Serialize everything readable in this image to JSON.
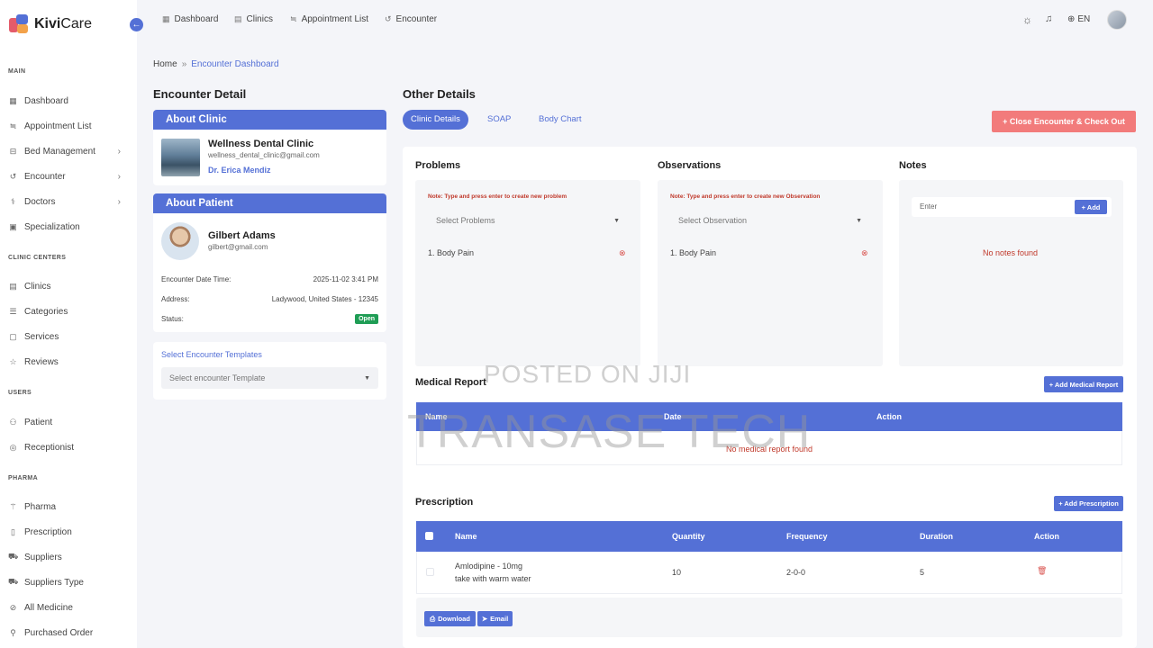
{
  "brand": {
    "name_a": "Kivi",
    "name_b": "Care"
  },
  "sidebar": {
    "sections": {
      "main": "MAIN",
      "clinic_centers": "CLINIC CENTERS",
      "users": "USERS",
      "pharma": "PHARMA"
    },
    "items": [
      {
        "label": "Dashboard",
        "icon": "grid-icon"
      },
      {
        "label": "Appointment List",
        "icon": "list-icon"
      },
      {
        "label": "Bed Management",
        "icon": "bed-icon"
      },
      {
        "label": "Encounter",
        "icon": "history-icon"
      },
      {
        "label": "Doctors",
        "icon": "doctor-icon"
      },
      {
        "label": "Specialization",
        "icon": "specialization-icon"
      },
      {
        "label": "Clinics",
        "icon": "clinic-icon"
      },
      {
        "label": "Categories",
        "icon": "categories-icon"
      },
      {
        "label": "Services",
        "icon": "services-icon"
      },
      {
        "label": "Reviews",
        "icon": "star-icon"
      },
      {
        "label": "Patient",
        "icon": "users-icon"
      },
      {
        "label": "Receptionist",
        "icon": "receptionist-icon"
      },
      {
        "label": "Pharma",
        "icon": "pharma-icon"
      },
      {
        "label": "Prescription",
        "icon": "prescription-icon"
      },
      {
        "label": "Suppliers",
        "icon": "suppliers-icon"
      },
      {
        "label": "Suppliers Type",
        "icon": "suppliers-type-icon"
      },
      {
        "label": "All Medicine",
        "icon": "medicine-icon"
      },
      {
        "label": "Purchased Order",
        "icon": "order-icon"
      }
    ]
  },
  "topnav": {
    "dashboard": "Dashboard",
    "clinics": "Clinics",
    "appointment_list": "Appointment List",
    "encounter": "Encounter",
    "lang": "EN"
  },
  "breadcrumb": {
    "home": "Home",
    "current": "Encounter Dashboard"
  },
  "encounter_detail": {
    "title": "Encounter Detail",
    "about_clinic": "About Clinic",
    "clinic_name": "Wellness Dental Clinic",
    "clinic_email": "wellness_dental_clinic@gmail.com",
    "doctor": "Dr. Erica Mendiz",
    "about_patient": "About Patient",
    "patient_name": "Gilbert Adams",
    "patient_email": "gilbert@gmail.com",
    "date_label": "Encounter Date Time:",
    "date_value": "2025-11-02 3:41 PM",
    "address_label": "Address:",
    "address_value": "Ladywood, United States - 12345",
    "status_label": "Status:",
    "status_value": "Open",
    "templates_label": "Select Encounter Templates",
    "templates_placeholder": "Select encounter Template"
  },
  "other_details": {
    "title": "Other Details",
    "tabs": [
      "Clinic Details",
      "SOAP",
      "Body Chart"
    ],
    "close_button": "+ Close Encounter & Check Out",
    "problems": {
      "title": "Problems",
      "note": "Note: Type and press enter to create new problem",
      "placeholder": "Select Problems",
      "items": [
        "1. Body Pain"
      ]
    },
    "observations": {
      "title": "Observations",
      "note": "Note: Type and press enter to create new Observation",
      "placeholder": "Select Observation",
      "items": [
        "1. Body Pain"
      ]
    },
    "notes": {
      "title": "Notes",
      "placeholder": "Enter",
      "add": "+ Add",
      "empty": "No notes found"
    },
    "medical_report": {
      "title": "Medical Report",
      "add": "+ Add Medical Report",
      "columns": [
        "Name",
        "Date",
        "Action"
      ],
      "empty": "No medical report found"
    },
    "prescription": {
      "title": "Prescription",
      "add": "+ Add Prescription",
      "columns": [
        "Name",
        "Quantity",
        "Frequency",
        "Duration",
        "Action"
      ],
      "rows": [
        {
          "name": "Amlodipine - 10mg",
          "instruction": "take with warm water",
          "quantity": "10",
          "frequency": "2-0-0",
          "duration": "5"
        }
      ],
      "download": "Download",
      "email": "Email"
    }
  },
  "watermark": {
    "line1": "POSTED ON JIJI",
    "line2": "TRANSASE TECH"
  },
  "colors": {
    "primary": "#5470d6",
    "danger": "#f27b7b",
    "success": "#1f9d55"
  }
}
